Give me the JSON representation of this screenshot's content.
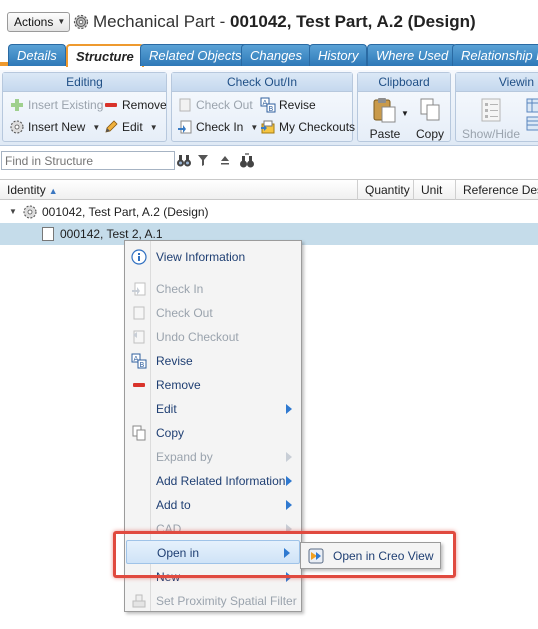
{
  "header": {
    "actions_label": "Actions",
    "title_prefix": "Mechanical Part - ",
    "title_bold": "001042, Test Part, A.2 (Design)"
  },
  "tabs": [
    {
      "label": "Details"
    },
    {
      "label": "Structure",
      "active": true
    },
    {
      "label": "Related Objects"
    },
    {
      "label": "Changes"
    },
    {
      "label": "History"
    },
    {
      "label": "Where Used"
    },
    {
      "label": "Relationship Ex"
    }
  ],
  "ribbon": {
    "editing": {
      "title": "Editing",
      "insert_existing": "Insert Existing",
      "remove": "Remove",
      "insert_new": "Insert New",
      "edit": "Edit"
    },
    "checkout": {
      "title": "Check Out/In",
      "check_out": "Check Out",
      "revise": "Revise",
      "check_in": "Check In",
      "my_checkouts": "My Checkouts"
    },
    "clipboard": {
      "title": "Clipboard",
      "paste": "Paste",
      "copy": "Copy"
    },
    "viewing": {
      "title": "Viewin",
      "show_hide": "Show/Hide"
    }
  },
  "search": {
    "placeholder": "Find in Structure"
  },
  "grid": {
    "columns": [
      "Identity",
      "Quantity",
      "Unit",
      "Reference Desig"
    ],
    "rows": [
      {
        "label": "001042, Test Part, A.2 (Design)"
      },
      {
        "label": "000142, Test 2, A.1"
      }
    ]
  },
  "context_menu": {
    "items": [
      {
        "label": "View Information",
        "icon": "info-icon"
      },
      {
        "label": "Check In",
        "disabled": true
      },
      {
        "label": "Check Out",
        "disabled": true
      },
      {
        "label": "Undo Checkout",
        "disabled": true
      },
      {
        "label": "Revise"
      },
      {
        "label": "Remove"
      },
      {
        "label": "Edit"
      },
      {
        "label": "Copy"
      },
      {
        "label": "Expand by",
        "disabled": true
      },
      {
        "label": "Add Related Information"
      },
      {
        "label": "Add to"
      },
      {
        "label": "CAD",
        "disabled": true
      },
      {
        "label": "Open in"
      },
      {
        "label": "New"
      },
      {
        "label": "Set Proximity Spatial Filter",
        "disabled": true
      }
    ]
  },
  "submenu": {
    "open_in_creo_view": "Open in Creo View"
  },
  "colors": {
    "tab_blue": "#2f79b8",
    "tab_accent": "#ee9a2f",
    "selection": "#c5dcea",
    "highlight_box": "#e04a3f"
  }
}
